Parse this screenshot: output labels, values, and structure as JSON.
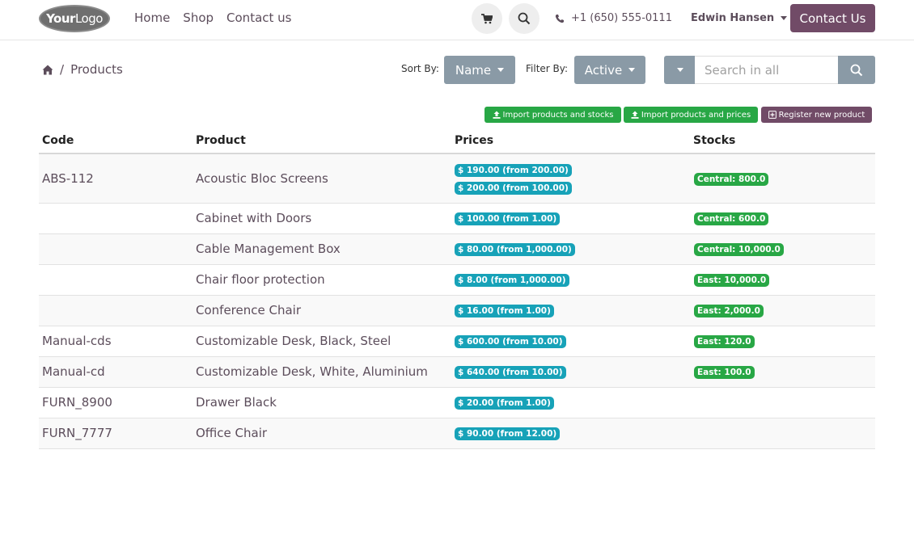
{
  "header": {
    "logo": {
      "bold": "Your",
      "light": "Logo"
    },
    "nav": [
      "Home",
      "Shop",
      "Contact us"
    ],
    "cart_icon": "shopping-cart-icon",
    "search_icon": "search-icon",
    "phone": "+1 (650) 555-0111",
    "user": "Edwin Hansen",
    "contact_button": "Contact Us"
  },
  "breadcrumb": {
    "home_icon": "home-icon",
    "separator": "/",
    "current": "Products"
  },
  "sort": {
    "label": "Sort By:",
    "value": "Name"
  },
  "filter": {
    "label": "Filter By:",
    "value": "Active"
  },
  "search": {
    "placeholder": "Search in all"
  },
  "actions": {
    "import_stocks": "Import products and stocks",
    "import_prices": "Import products and prices",
    "register": "Register new product"
  },
  "table": {
    "columns": [
      "Code",
      "Product",
      "Prices",
      "Stocks"
    ],
    "rows": [
      {
        "code": "ABS-112",
        "product": "Acoustic Bloc Screens",
        "prices": [
          "$ 190.00 (from 200.00)",
          "$ 200.00 (from 100.00)"
        ],
        "stocks": [
          "Central: 800.0"
        ]
      },
      {
        "code": "",
        "product": "Cabinet with Doors",
        "prices": [
          "$ 100.00 (from 1.00)"
        ],
        "stocks": [
          "Central: 600.0"
        ]
      },
      {
        "code": "",
        "product": "Cable Management Box",
        "prices": [
          "$ 80.00 (from 1,000.00)"
        ],
        "stocks": [
          "Central: 10,000.0"
        ]
      },
      {
        "code": "",
        "product": "Chair floor protection",
        "prices": [
          "$ 8.00 (from 1,000.00)"
        ],
        "stocks": [
          "East: 10,000.0"
        ]
      },
      {
        "code": "",
        "product": "Conference Chair",
        "prices": [
          "$ 16.00 (from 1.00)"
        ],
        "stocks": [
          "East: 2,000.0"
        ]
      },
      {
        "code": "Manual-cds",
        "product": "Customizable Desk, Black, Steel",
        "prices": [
          "$ 600.00 (from 10.00)"
        ],
        "stocks": [
          "East: 120.0"
        ]
      },
      {
        "code": "Manual-cd",
        "product": "Customizable Desk, White, Aluminium",
        "prices": [
          "$ 640.00 (from 10.00)"
        ],
        "stocks": [
          "East: 100.0"
        ]
      },
      {
        "code": "FURN_8900",
        "product": "Drawer Black",
        "prices": [
          "$ 20.00 (from 1.00)"
        ],
        "stocks": []
      },
      {
        "code": "FURN_7777",
        "product": "Office Chair",
        "prices": [
          "$ 90.00 (from 12.00)"
        ],
        "stocks": []
      }
    ]
  },
  "colors": {
    "primary": "#714b67",
    "gray_button": "#8a9aa6",
    "price_badge": "#17a2b8",
    "stock_badge": "#28a745",
    "text": "#5c4d5b"
  }
}
